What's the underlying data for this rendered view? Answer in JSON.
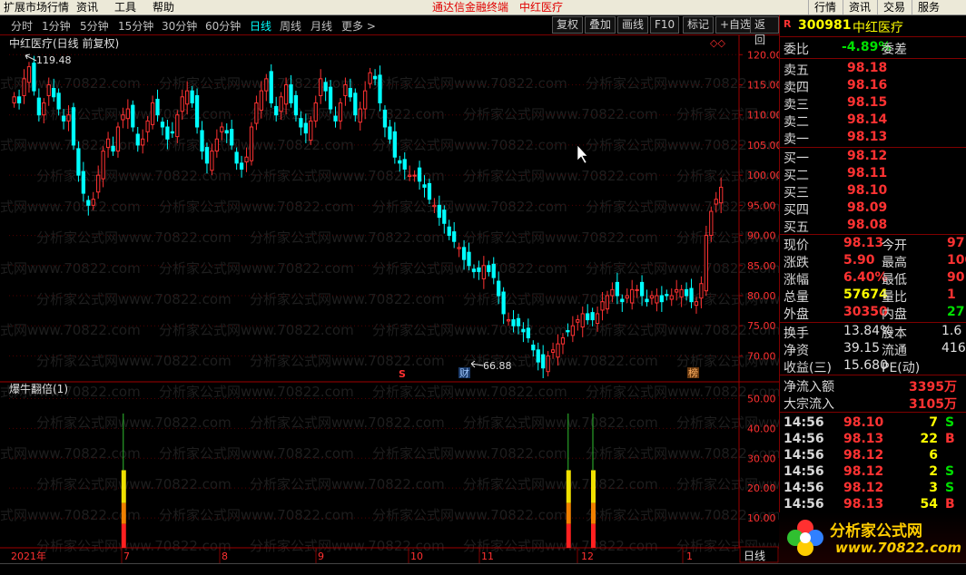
{
  "menubar": {
    "items": [
      "扩展市场行情",
      "资讯",
      "工具",
      "帮助"
    ],
    "center_title": "通达信金融终端",
    "center_stock": "中红医疗",
    "right_items": [
      "行情",
      "资讯",
      "交易",
      "服务"
    ]
  },
  "toolbar": {
    "periods": [
      "分时",
      "1分钟",
      "5分钟",
      "15分钟",
      "30分钟",
      "60分钟",
      "日线",
      "周线",
      "月线",
      "更多 >"
    ],
    "active_period": "日线",
    "buttons": [
      "复权",
      "叠加",
      "画线",
      "F10",
      "标记",
      "+自选",
      "返回"
    ]
  },
  "chart": {
    "title": "中红医疗(日线 前复权)",
    "high_label": "119.48",
    "low_label": "66.88",
    "price_ticks": [
      "120.00",
      "115.00",
      "110.00",
      "105.00",
      "100.00",
      "95.00",
      "90.00",
      "85.00",
      "80.00",
      "75.00",
      "70.00"
    ],
    "markers": [
      {
        "text": "S",
        "color": "#ff3030"
      },
      {
        "text": "财",
        "color": "#6fa8ff"
      },
      {
        "text": "榜",
        "color": "#ffa040"
      }
    ],
    "indicator_title": "爆牛翻倍(1)",
    "indicator_ticks": [
      "50.00",
      "40.00",
      "30.00",
      "20.00",
      "10.00"
    ],
    "date_labels": [
      "2021年",
      "7",
      "8",
      "9",
      "10",
      "11",
      "12",
      "1"
    ],
    "period_label": "日线",
    "watermark": "分析家公式网www.70822.com"
  },
  "chart_data": {
    "type": "candlestick",
    "ylim": [
      66,
      122
    ],
    "closes": [
      113,
      112,
      116,
      118,
      114,
      110,
      112,
      115,
      113,
      111,
      109,
      110,
      105,
      100,
      97,
      95,
      96,
      100,
      104,
      106,
      104,
      108,
      110,
      111,
      108,
      105,
      106,
      109,
      112,
      110,
      108,
      106,
      107,
      110,
      113,
      114,
      112,
      108,
      104,
      102,
      104,
      106,
      108,
      107,
      105,
      102,
      101,
      103,
      108,
      112,
      114,
      116,
      112,
      110,
      113,
      115,
      112,
      110,
      108,
      107,
      109,
      112,
      116,
      114,
      111,
      109,
      112,
      115,
      113,
      110,
      111,
      114,
      117,
      116,
      112,
      108,
      106,
      103,
      102,
      101,
      100,
      100,
      99,
      98,
      96,
      95,
      93,
      92,
      90,
      89,
      88,
      86,
      85,
      84,
      84,
      85,
      84,
      83,
      80,
      77,
      76,
      75,
      75,
      74,
      73,
      71,
      69,
      68,
      70,
      71,
      72,
      73,
      74,
      75,
      76,
      77,
      76,
      76,
      77,
      79,
      80,
      81,
      80,
      79,
      80,
      81,
      81,
      80,
      79,
      80,
      80,
      79,
      80,
      80,
      81,
      81,
      80,
      79,
      79,
      82,
      90,
      94,
      96,
      98
    ],
    "indicator": {
      "ylim": [
        0,
        55
      ],
      "events": [
        {
          "bar_index": 22,
          "values": {
            "red": 8,
            "orange": 15,
            "yellow": 26,
            "green_top": 45
          }
        },
        {
          "bar_index": 112,
          "values": {
            "red": 8,
            "orange": 15,
            "yellow": 26,
            "green_top": 45
          }
        },
        {
          "bar_index": 117,
          "values": {
            "red": 8,
            "orange": 15,
            "yellow": 26,
            "green_top": 45
          }
        }
      ]
    }
  },
  "quote": {
    "code": "300981",
    "name": "中红医疗",
    "weibi_label": "委比",
    "weibi_val": "-4.89%",
    "weicha_label": "委差",
    "asks": [
      {
        "label": "卖五",
        "price": "98.18"
      },
      {
        "label": "卖四",
        "price": "98.16"
      },
      {
        "label": "卖三",
        "price": "98.15"
      },
      {
        "label": "卖二",
        "price": "98.14"
      },
      {
        "label": "卖一",
        "price": "98.13"
      }
    ],
    "bids": [
      {
        "label": "买一",
        "price": "98.12"
      },
      {
        "label": "买二",
        "price": "98.11"
      },
      {
        "label": "买三",
        "price": "98.10"
      },
      {
        "label": "买四",
        "price": "98.09"
      },
      {
        "label": "买五",
        "price": "98.08"
      }
    ],
    "stats": [
      {
        "l1": "现价",
        "v1": "98.13",
        "l2": "今开",
        "v2": "97"
      },
      {
        "l1": "涨跌",
        "v1": "5.90",
        "l2": "最高",
        "v2": "100"
      },
      {
        "l1": "涨幅",
        "v1": "6.40%",
        "l2": "最低",
        "v2": "90"
      },
      {
        "l1": "总量",
        "v1": "57674",
        "l2": "量比",
        "v2": "1"
      },
      {
        "l1": "外盘",
        "v1": "30350",
        "l2": "内盘",
        "v2": "27"
      }
    ],
    "stats2": [
      {
        "l1": "换手",
        "v1": "13.84%",
        "l2": "股本",
        "v2": "1.6"
      },
      {
        "l1": "净资",
        "v1": "39.15",
        "l2": "流通",
        "v2": "416"
      },
      {
        "l1": "收益(三)",
        "v1": "15.680",
        "l2": "PE(动)",
        "v2": ""
      }
    ],
    "flows": [
      {
        "label": "净流入额",
        "val": "3395万"
      },
      {
        "label": "大宗流入",
        "val": "3105万"
      }
    ],
    "ticks": [
      {
        "time": "14:56",
        "price": "98.10",
        "vol": "7",
        "side": "S"
      },
      {
        "time": "14:56",
        "price": "98.13",
        "vol": "22",
        "side": "B"
      },
      {
        "time": "14:56",
        "price": "98.12",
        "vol": "6",
        "side": ""
      },
      {
        "time": "14:56",
        "price": "98.12",
        "vol": "2",
        "side": "S"
      },
      {
        "time": "14:56",
        "price": "98.12",
        "vol": "3",
        "side": "S"
      },
      {
        "time": "14:56",
        "price": "98.13",
        "vol": "54",
        "side": "B"
      }
    ]
  },
  "logo": {
    "name": "分析家公式网",
    "url": "www.70822.com"
  },
  "colors": {
    "up": "#ff3232",
    "down": "#00ffff",
    "grid": "#800000",
    "accent": "#ffff00"
  }
}
